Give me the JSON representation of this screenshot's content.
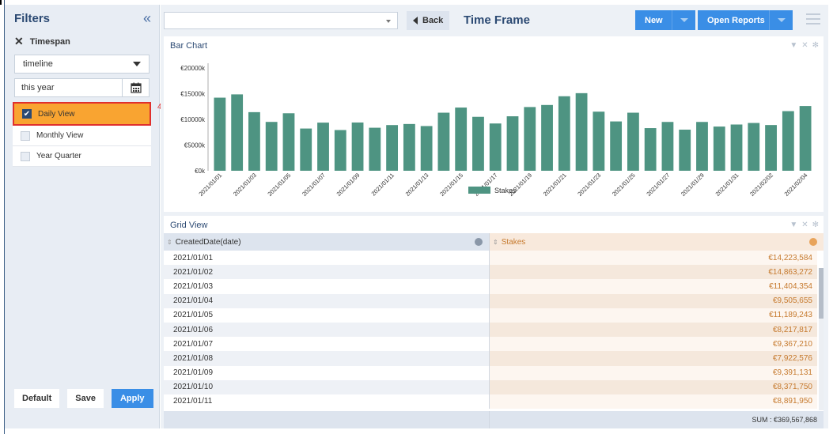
{
  "filters": {
    "title": "Filters",
    "section": "Timespan",
    "timeline_value": "timeline",
    "date_value": "this year",
    "views": [
      "Daily View",
      "Monthly View",
      "Year Quarter"
    ],
    "active_view": "Daily View",
    "step_marker": "4.",
    "buttons": {
      "default": "Default",
      "save": "Save",
      "apply": "Apply"
    }
  },
  "toolbar": {
    "back_label": "Back",
    "title": "Time Frame",
    "new_label": "New",
    "open_reports_label": "Open Reports"
  },
  "chart_panel": {
    "title": "Bar Chart"
  },
  "grid_panel": {
    "title": "Grid View",
    "col_date": "CreatedDate(date)",
    "col_stakes": "Stakes",
    "rows": [
      [
        "2021/01/01",
        "€14,223,584"
      ],
      [
        "2021/01/02",
        "€14,863,272"
      ],
      [
        "2021/01/03",
        "€11,404,354"
      ],
      [
        "2021/01/04",
        "€9,505,655"
      ],
      [
        "2021/01/05",
        "€11,189,243"
      ],
      [
        "2021/01/06",
        "€8,217,817"
      ],
      [
        "2021/01/07",
        "€9,367,210"
      ],
      [
        "2021/01/08",
        "€7,922,576"
      ],
      [
        "2021/01/09",
        "€9,391,131"
      ],
      [
        "2021/01/10",
        "€8,371,750"
      ],
      [
        "2021/01/11",
        "€8,891,950"
      ]
    ],
    "sum": "SUM : €369,567,868"
  },
  "chart_data": {
    "type": "bar",
    "categories": [
      "2021/01/01",
      "2021/01/02",
      "2021/01/03",
      "2021/01/04",
      "2021/01/05",
      "2021/01/06",
      "2021/01/07",
      "2021/01/08",
      "2021/01/09",
      "2021/01/10",
      "2021/01/11",
      "2021/01/12",
      "2021/01/13",
      "2021/01/14",
      "2021/01/15",
      "2021/01/16",
      "2021/01/17",
      "2021/01/18",
      "2021/01/19",
      "2021/01/20",
      "2021/01/21",
      "2021/01/22",
      "2021/01/23",
      "2021/01/24",
      "2021/01/25",
      "2021/01/26",
      "2021/01/27",
      "2021/01/28",
      "2021/01/29",
      "2021/01/30",
      "2021/01/31",
      "2021/02/01",
      "2021/02/02",
      "2021/02/03",
      "2021/02/04"
    ],
    "tick_labels": [
      "2021/01/01",
      "2021/01/03",
      "2021/01/05",
      "2021/01/07",
      "2021/01/09",
      "2021/01/11",
      "2021/01/13",
      "2021/01/15",
      "2021/01/17",
      "2021/01/19",
      "2021/01/21",
      "2021/01/23",
      "2021/01/25",
      "2021/01/27",
      "2021/01/29",
      "2021/01/31",
      "2021/02/02",
      "2021/02/04"
    ],
    "series": [
      {
        "name": "Stakes",
        "values": [
          14224,
          14863,
          11404,
          9506,
          11189,
          8218,
          9367,
          7923,
          9391,
          8372,
          8892,
          9100,
          8700,
          11300,
          12300,
          10500,
          9200,
          10600,
          12400,
          12800,
          14500,
          15100,
          11500,
          9600,
          11300,
          8300,
          9500,
          8000,
          9500,
          8600,
          9000,
          9300,
          8900,
          11600,
          12600
        ]
      }
    ],
    "ylabel": "",
    "xlabel": "",
    "ylim": [
      0,
      20000
    ],
    "yticks": [
      "€0k",
      "€5000k",
      "€10000k",
      "€15000k",
      "€20000k"
    ],
    "color": "#4e9482",
    "legend": "bottom"
  }
}
